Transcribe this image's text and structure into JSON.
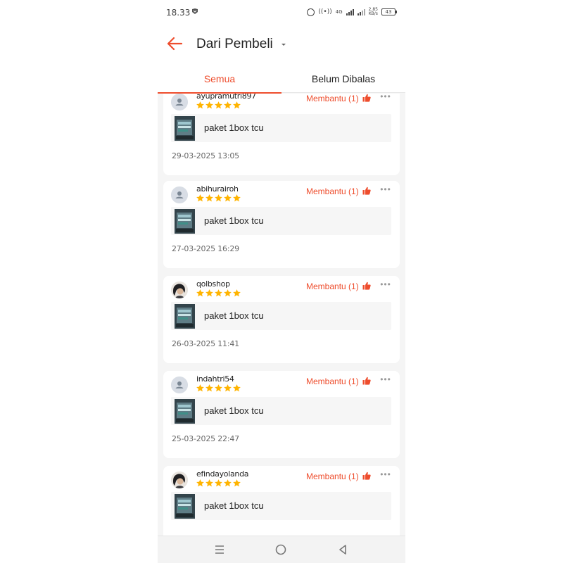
{
  "status_bar": {
    "time": "18.33",
    "network_label": "4G",
    "speed_value": "2,85",
    "speed_unit": "KB/s",
    "battery": "43"
  },
  "header": {
    "title": "Dari Pembeli"
  },
  "tabs": [
    {
      "label": "Semua",
      "active": true
    },
    {
      "label": "Belum Dibalas",
      "active": false
    }
  ],
  "reviews": [
    {
      "username": "ayupramutri897",
      "rating": 5,
      "helpful_label": "Membantu (1)",
      "product_name": "paket 1box tcu",
      "date": "29-03-2025 13:05",
      "avatar": "default-avatar"
    },
    {
      "username": "abihurairoh",
      "rating": 5,
      "helpful_label": "Membantu (1)",
      "product_name": "paket 1box tcu",
      "date": "27-03-2025 16:29",
      "avatar": "default-avatar"
    },
    {
      "username": "qolbshop",
      "rating": 5,
      "helpful_label": "Membantu (1)",
      "product_name": "paket 1box tcu",
      "date": "26-03-2025 11:41",
      "avatar": "photo-avatar"
    },
    {
      "username": "indahtri54",
      "rating": 5,
      "helpful_label": "Membantu (1)",
      "product_name": "paket 1box tcu",
      "date": "25-03-2025 22:47",
      "avatar": "default-avatar"
    },
    {
      "username": "efindayolanda",
      "rating": 5,
      "helpful_label": "Membantu (1)",
      "product_name": "paket 1box tcu",
      "date": "",
      "avatar": "photo-avatar"
    }
  ],
  "colors": {
    "accent": "#ee4d2d",
    "star": "#ffb400",
    "background": "#f5f5f5"
  },
  "icons": {
    "back": "arrow-left-icon",
    "dropdown": "caret-down-icon",
    "helpful": "thumbs-up-icon",
    "more": "more-dots-icon",
    "nav_recents": "menu-lines-icon",
    "nav_home": "circle-icon",
    "nav_back": "triangle-back-icon"
  }
}
